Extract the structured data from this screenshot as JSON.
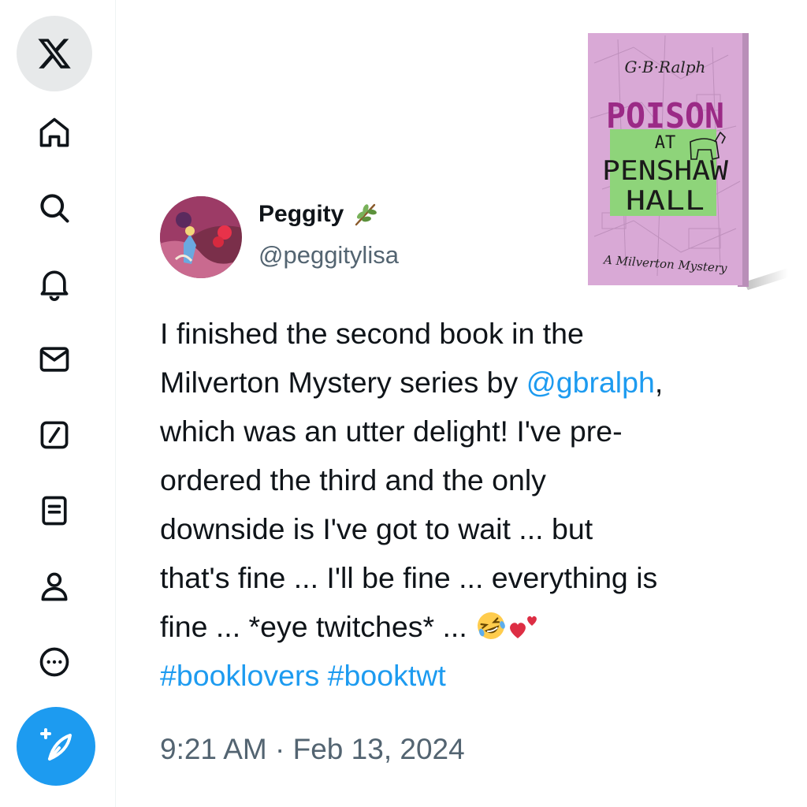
{
  "colors": {
    "accent": "#1d9bf0",
    "secondary_text": "#536471",
    "primary_text": "#0f1419"
  },
  "sidebar": {
    "items": [
      {
        "icon": "x-logo-icon"
      },
      {
        "icon": "home-icon"
      },
      {
        "icon": "search-icon"
      },
      {
        "icon": "bell-icon"
      },
      {
        "icon": "mail-icon"
      },
      {
        "icon": "grok-icon"
      },
      {
        "icon": "lists-icon"
      },
      {
        "icon": "profile-icon"
      },
      {
        "icon": "more-icon"
      },
      {
        "icon": "compose-icon"
      }
    ]
  },
  "tweet": {
    "author": {
      "display_name": "Peggity",
      "handle": "@peggitylisa",
      "badge": "herb-emoji"
    },
    "lines": [
      {
        "text": "I finished the second book in the"
      },
      {
        "pre": "Milverton Mystery series by ",
        "mention": "@gbralph",
        "post": ","
      },
      {
        "text": "which was an utter delight! I've pre-"
      },
      {
        "text": "ordered the third and the only"
      },
      {
        "text": "downside is I've got to wait ... but"
      },
      {
        "text": "that's fine ... I'll be fine ... everything is"
      },
      {
        "pre": "fine ... *eye twitches* ... "
      }
    ],
    "hashtags": [
      "#booklovers",
      "#booktwt"
    ],
    "emojis": [
      "rolling-laughing-emoji",
      "two-hearts-emoji"
    ],
    "timestamp": "9:21 AM · Feb 13, 2024"
  },
  "book_image": {
    "author": "G·B·Ralph",
    "title_line1": "POISON",
    "title_line2": "AT",
    "title_line3": "PENSHAW",
    "title_line4": "HALL",
    "subtitle": "A Milverton Mystery"
  }
}
